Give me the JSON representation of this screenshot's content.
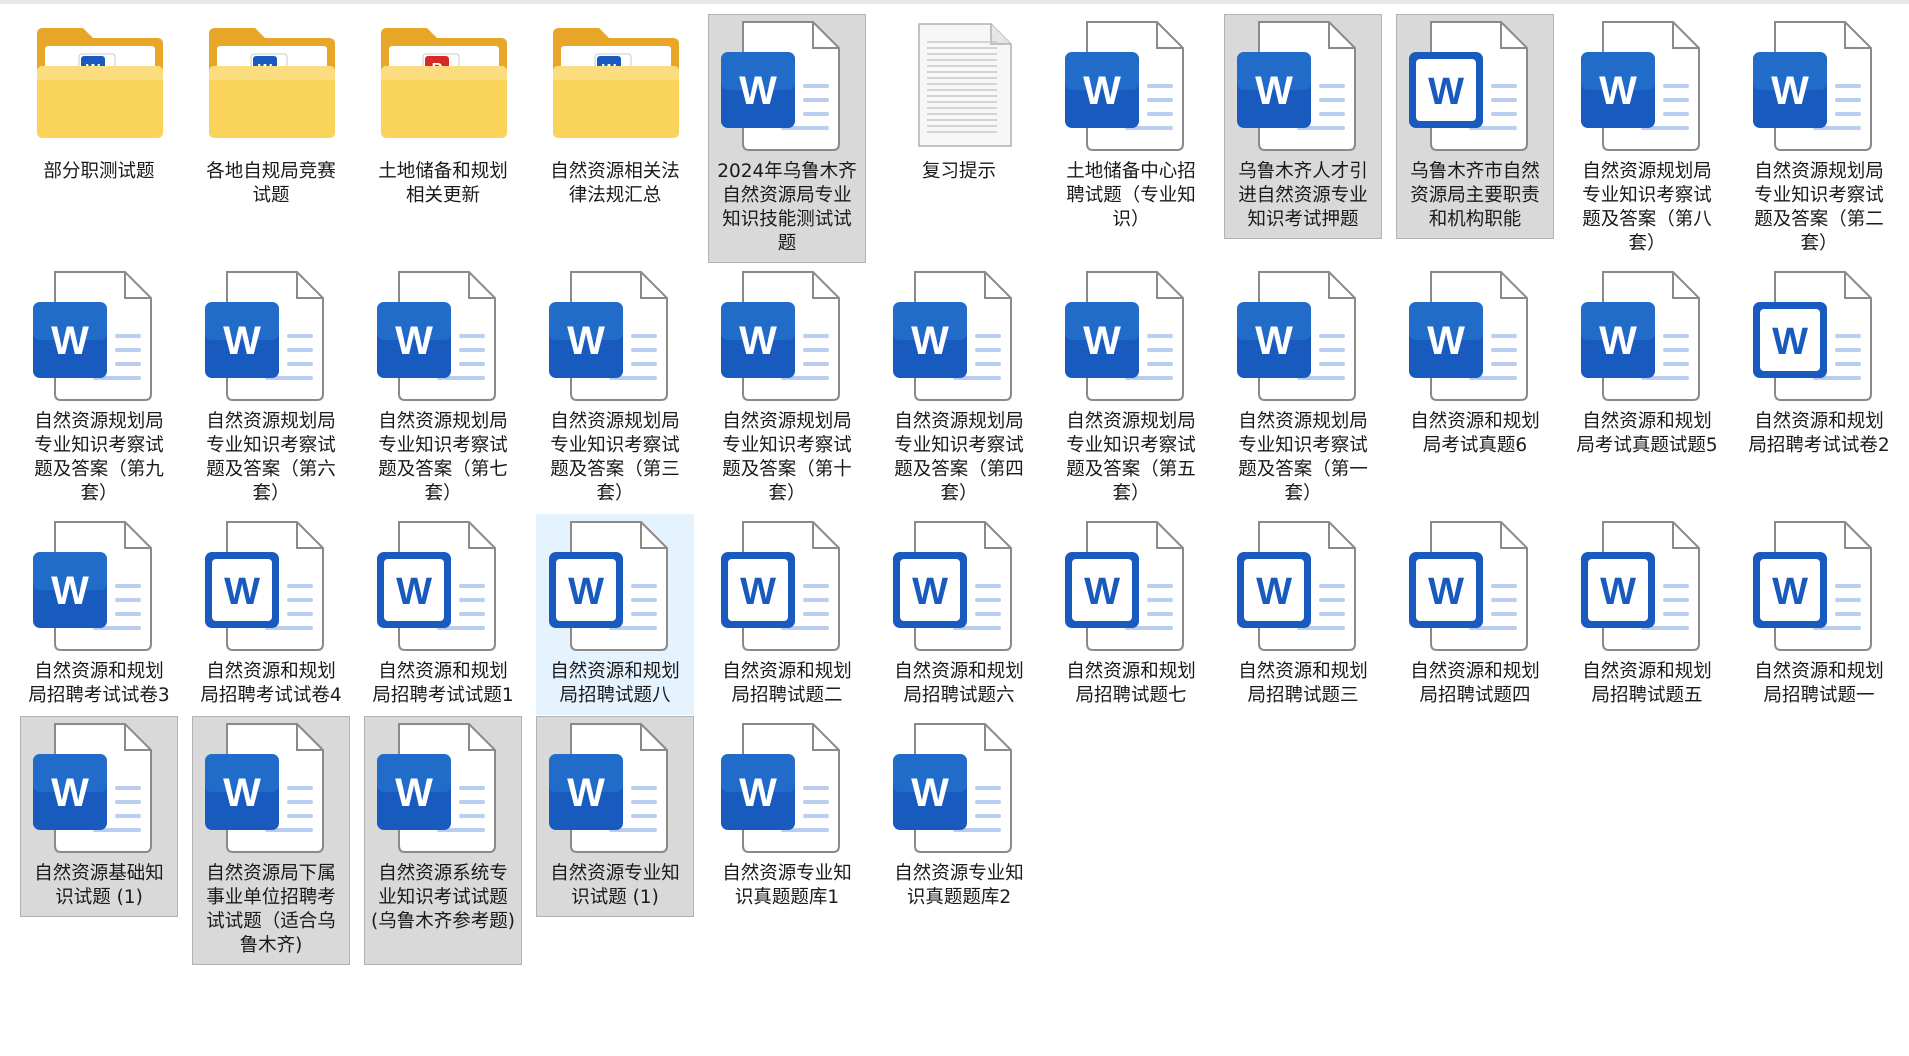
{
  "colors": {
    "selected_bg": "#d9d9d9",
    "hover_bg": "#e5f3ff",
    "word_blue": "#185abd",
    "folder_yellow": "#f7c94a"
  },
  "items": [
    {
      "label": "部分职测试题",
      "type": "folder",
      "badge": "word",
      "state": ""
    },
    {
      "label": "各地自规局竞赛试题",
      "type": "folder",
      "badge": "word",
      "state": ""
    },
    {
      "label": "土地储备和规划相关更新",
      "type": "folder",
      "badge": "pdf",
      "state": ""
    },
    {
      "label": "自然资源相关法律法规汇总",
      "type": "folder",
      "badge": "word",
      "state": ""
    },
    {
      "label": "2024年乌鲁木齐自然资源局专业知识技能测试试题",
      "type": "word",
      "state": "selected"
    },
    {
      "label": "复习提示",
      "type": "text",
      "state": ""
    },
    {
      "label": "土地储备中心招聘试题（专业知识）",
      "type": "word",
      "state": ""
    },
    {
      "label": "乌鲁木齐人才引进自然资源专业知识考试押题",
      "type": "word",
      "state": "selected"
    },
    {
      "label": "乌鲁木齐市自然资源局主要职责和机构职能",
      "type": "word-outline",
      "state": "selected"
    },
    {
      "label": "自然资源规划局专业知识考察试题及答案（第八套）",
      "type": "word",
      "state": ""
    },
    {
      "label": "自然资源规划局专业知识考察试题及答案（第二套）",
      "type": "word",
      "state": ""
    },
    {
      "label": "自然资源规划局专业知识考察试题及答案（第九套）",
      "type": "word",
      "state": ""
    },
    {
      "label": "自然资源规划局专业知识考察试题及答案（第六套）",
      "type": "word",
      "state": ""
    },
    {
      "label": "自然资源规划局专业知识考察试题及答案（第七套）",
      "type": "word",
      "state": ""
    },
    {
      "label": "自然资源规划局专业知识考察试题及答案（第三套）",
      "type": "word",
      "state": ""
    },
    {
      "label": "自然资源规划局专业知识考察试题及答案（第十套）",
      "type": "word",
      "state": ""
    },
    {
      "label": "自然资源规划局专业知识考察试题及答案（第四套）",
      "type": "word",
      "state": ""
    },
    {
      "label": "自然资源规划局专业知识考察试题及答案（第五套）",
      "type": "word",
      "state": ""
    },
    {
      "label": "自然资源规划局专业知识考察试题及答案（第一套）",
      "type": "word",
      "state": ""
    },
    {
      "label": "自然资源和规划局考试真题6",
      "type": "word",
      "state": ""
    },
    {
      "label": "自然资源和规划局考试真题试题5",
      "type": "word",
      "state": ""
    },
    {
      "label": "自然资源和规划局招聘考试试卷2",
      "type": "word-outline",
      "state": ""
    },
    {
      "label": "自然资源和规划局招聘考试试卷3",
      "type": "word",
      "state": ""
    },
    {
      "label": "自然资源和规划局招聘考试试卷4",
      "type": "word-outline",
      "state": ""
    },
    {
      "label": "自然资源和规划局招聘考试试题1",
      "type": "word-outline",
      "state": ""
    },
    {
      "label": "自然资源和规划局招聘试题八",
      "type": "word-outline",
      "state": "hover"
    },
    {
      "label": "自然资源和规划局招聘试题二",
      "type": "word-outline",
      "state": ""
    },
    {
      "label": "自然资源和规划局招聘试题六",
      "type": "word-outline",
      "state": ""
    },
    {
      "label": "自然资源和规划局招聘试题七",
      "type": "word-outline",
      "state": ""
    },
    {
      "label": "自然资源和规划局招聘试题三",
      "type": "word-outline",
      "state": ""
    },
    {
      "label": "自然资源和规划局招聘试题四",
      "type": "word-outline",
      "state": ""
    },
    {
      "label": "自然资源和规划局招聘试题五",
      "type": "word-outline",
      "state": ""
    },
    {
      "label": "自然资源和规划局招聘试题一",
      "type": "word-outline",
      "state": ""
    },
    {
      "label": "自然资源基础知识试题 (1)",
      "type": "word",
      "state": "selected"
    },
    {
      "label": "自然资源局下属事业单位招聘考试试题（适合乌鲁木齐)",
      "type": "word",
      "state": "selected"
    },
    {
      "label": "自然资源系统专业知识考试试题 (乌鲁木齐参考题)",
      "type": "word",
      "state": "selected"
    },
    {
      "label": "自然资源专业知识试题 (1)",
      "type": "word",
      "state": "selected"
    },
    {
      "label": "自然资源专业知识真题题库1",
      "type": "word",
      "state": ""
    },
    {
      "label": "自然资源专业知识真题题库2",
      "type": "word",
      "state": ""
    }
  ]
}
